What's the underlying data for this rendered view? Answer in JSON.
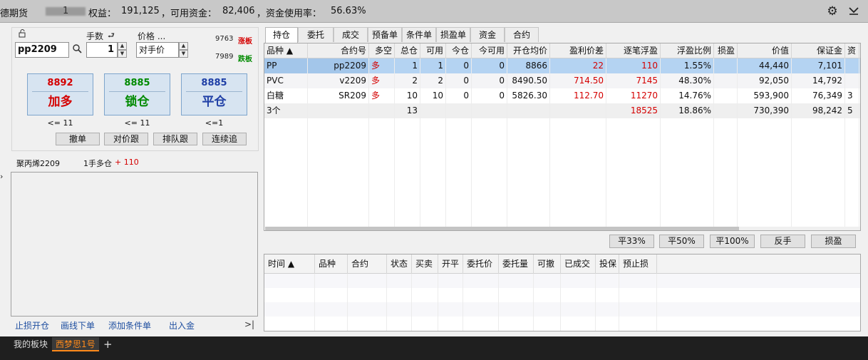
{
  "topbar": {
    "title_prefix": "德期货",
    "account_masked": "1",
    "equity_label": "权益：",
    "equity_value": "191,125",
    "available_label": "，可用资金：",
    "available_value": "82,406",
    "usage_label": "，资金使用率：",
    "usage_value": "56.63%",
    "settings_icon": "gear-icon",
    "collapse_icon": "chevron-down-icon"
  },
  "order_panel": {
    "lock_icon": "lock-icon",
    "qty_label": "手数",
    "price_label": "价格 ...",
    "contract": "pp2209",
    "qty": "1",
    "price_mode": "对手价",
    "limit_up_price": "9763",
    "limit_up_label": "涨板",
    "limit_down_price": "7989",
    "limit_down_label": "跌板",
    "buttons": [
      {
        "price": "8892",
        "label": "加多",
        "limit": "<= 11",
        "color": "#d40000"
      },
      {
        "price": "8885",
        "label": "锁仓",
        "limit": "<= 11",
        "color": "#008a00"
      },
      {
        "price": "8885",
        "label": "平仓",
        "limit": "<=1",
        "color": "#1f3fa6"
      }
    ],
    "small_buttons": [
      "撤单",
      "对价跟",
      "排队跟",
      "连续追"
    ],
    "info_contract": "聚丙烯2209",
    "info_position": "1手多仓",
    "info_pnl": "+ 110",
    "links": [
      "止损开仓",
      "画线下单",
      "添加条件单",
      "出入金"
    ],
    "expand_glyph": ">|"
  },
  "tabs": [
    "持仓",
    "委托",
    "成交",
    "预备单",
    "条件单",
    "损盈单",
    "资金",
    "合约"
  ],
  "positions": {
    "columns": [
      "品种 ▲",
      "合约号",
      "多空",
      "总仓",
      "可用",
      "今仓",
      "今可用",
      "开仓均价",
      "盈利价差",
      "逐笔浮盈",
      "浮盈比例",
      "损盈",
      "价值",
      "保证金",
      "资"
    ],
    "rows": [
      [
        "PP",
        "pp2209",
        "多",
        "1",
        "1",
        "0",
        "0",
        "8866",
        "22",
        "110",
        "1.55%",
        "",
        "44,440",
        "7,101",
        ""
      ],
      [
        "PVC",
        "v2209",
        "多",
        "2",
        "2",
        "0",
        "0",
        "8490.50",
        "714.50",
        "7145",
        "48.30%",
        "",
        "92,050",
        "14,792",
        ""
      ],
      [
        "白糖",
        "SR209",
        "多",
        "10",
        "10",
        "0",
        "0",
        "5826.30",
        "112.70",
        "11270",
        "14.76%",
        "",
        "593,900",
        "76,349",
        "3"
      ],
      [
        "3个",
        "",
        "",
        "13",
        "",
        "",
        "",
        "",
        "",
        "18525",
        "18.86%",
        "",
        "730,390",
        "98,242",
        "5"
      ]
    ]
  },
  "action_buttons": [
    "平33%",
    "平50%",
    "平100%",
    "反手",
    "损盈"
  ],
  "orders": {
    "columns": [
      "时间 ▲",
      "品种",
      "合约",
      "状态",
      "买卖",
      "开平",
      "委托价",
      "委托量",
      "可撤",
      "已成交",
      "投保",
      "预止损"
    ]
  },
  "bottom_tabs": [
    "我的板块",
    "西梦思1号",
    "+"
  ]
}
